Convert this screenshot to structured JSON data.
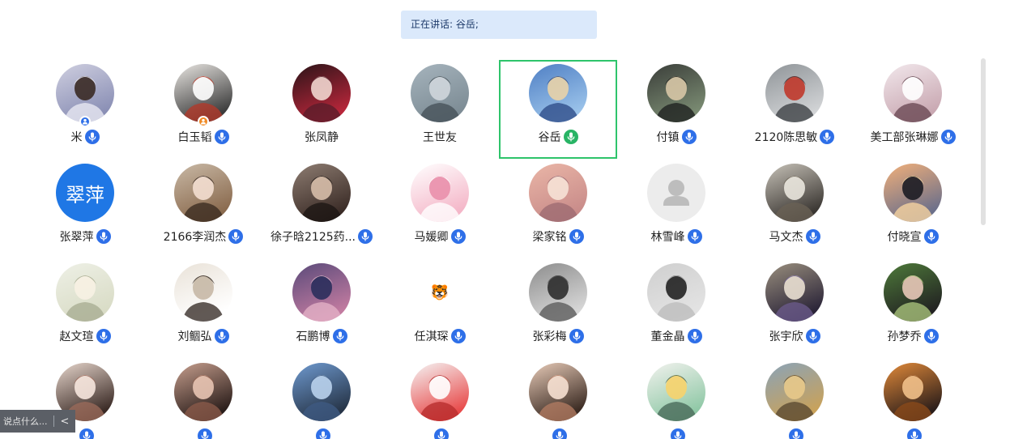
{
  "speaking": {
    "text": "正在讲话: 谷岳;"
  },
  "chat": {
    "placeholder": "说点什么...",
    "collapse_glyph": "<"
  },
  "colors": {
    "active_border": "#2ec46b",
    "mic_blue": "#2e6fe8",
    "mic_green": "#28b465",
    "banner_bg": "#dbe9fb"
  },
  "participants": [
    {
      "name": "米",
      "mic": "blue",
      "host_badge": "blue",
      "avatar": "photo-cartoon-boy"
    },
    {
      "name": "白玉韬",
      "mic": "blue",
      "host_badge": "orange",
      "avatar": "photo-comic-cat"
    },
    {
      "name": "张凤静",
      "mic": "none",
      "avatar": "photo-anime-girl-red-hat"
    },
    {
      "name": "王世友",
      "mic": "none",
      "avatar": "photo-seaside-man"
    },
    {
      "name": "谷岳",
      "mic": "green",
      "active": true,
      "avatar": "photo-anime-blue-art"
    },
    {
      "name": "付镇",
      "mic": "blue",
      "avatar": "photo-anime-boys"
    },
    {
      "name": "2120陈思敏",
      "mic": "blue",
      "avatar": "photo-street-figure"
    },
    {
      "name": "美工部张琳娜",
      "mic": "blue",
      "avatar": "photo-sketch-girl"
    },
    {
      "name": "张翠萍",
      "mic": "blue",
      "avatar": "text",
      "avatar_text": "翠萍"
    },
    {
      "name": "2166李润杰",
      "mic": "blue",
      "avatar": "photo-child-pigtails"
    },
    {
      "name": "徐子晗2125药...",
      "mic": "blue",
      "avatar": "photo-woman-dark-hair"
    },
    {
      "name": "马媛卿",
      "mic": "blue",
      "avatar": "photo-pink-piglet"
    },
    {
      "name": "梁家铭",
      "mic": "blue",
      "avatar": "photo-pink-rabbit-sky"
    },
    {
      "name": "林雪峰",
      "mic": "blue",
      "avatar": "default-person"
    },
    {
      "name": "马文杰",
      "mic": "blue",
      "avatar": "photo-man-magazine"
    },
    {
      "name": "付晓宣",
      "mic": "blue",
      "avatar": "photo-sunset-silhouette"
    },
    {
      "name": "赵文瑄",
      "mic": "blue",
      "avatar": "photo-anime-white-hair"
    },
    {
      "name": "刘鲴弘",
      "mic": "blue",
      "avatar": "photo-white-puppy"
    },
    {
      "name": "石鹏博",
      "mic": "blue",
      "avatar": "photo-girl-sea"
    },
    {
      "name": "任淇琛",
      "mic": "blue",
      "avatar": "emoji-tiger",
      "avatar_text": "🐯"
    },
    {
      "name": "张彩梅",
      "mic": "blue",
      "avatar": "photo-bw-portrait"
    },
    {
      "name": "董金晶",
      "mic": "blue",
      "avatar": "photo-grumpy-face"
    },
    {
      "name": "张宇欣",
      "mic": "blue",
      "avatar": "photo-kuromi-doll"
    },
    {
      "name": "孙梦乔",
      "mic": "blue",
      "avatar": "photo-girl-flowers"
    },
    {
      "name": "",
      "mic": "blue",
      "avatar": "photo-little-girl"
    },
    {
      "name": "",
      "mic": "blue",
      "avatar": "photo-face-closeup"
    },
    {
      "name": "",
      "mic": "blue",
      "avatar": "photo-boy-sky"
    },
    {
      "name": "",
      "mic": "blue",
      "avatar": "photo-red-pig-sticker"
    },
    {
      "name": "",
      "mic": "blue",
      "avatar": "photo-toddler-face"
    },
    {
      "name": "",
      "mic": "blue",
      "avatar": "photo-cartoon-boy-green"
    },
    {
      "name": "",
      "mic": "blue",
      "avatar": "photo-golden-dog"
    },
    {
      "name": "",
      "mic": "blue",
      "avatar": "photo-girl-orange"
    }
  ]
}
